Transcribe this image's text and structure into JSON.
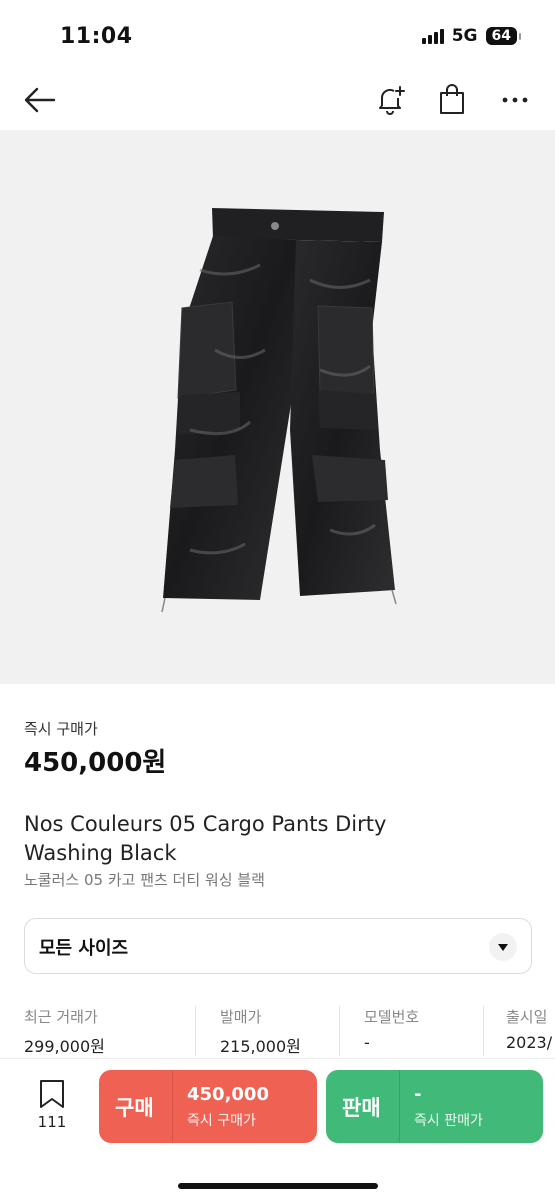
{
  "status_bar": {
    "time": "11:04",
    "network": "5G",
    "battery": "64"
  },
  "nav": {
    "back_icon": "arrow-left-icon",
    "icons": [
      "bell-plus-icon",
      "shopping-bag-icon",
      "more-horizontal-icon"
    ]
  },
  "product": {
    "price_label": "즉시 구매가",
    "price": "450,000원",
    "title_en": "Nos Couleurs 05 Cargo Pants Dirty Washing Black",
    "title_ko": "노쿨러스 05 카고 팬츠 더티 워싱 블랙",
    "size_select": "모든 사이즈"
  },
  "stats": [
    {
      "label": "최근 거래가",
      "value": "299,000원"
    },
    {
      "label": "발매가",
      "value": "215,000원"
    },
    {
      "label": "모델번호",
      "value": "-"
    },
    {
      "label": "출시일",
      "value": "2023/"
    }
  ],
  "bottom_bar": {
    "bookmark_count": "111",
    "buy": {
      "label": "구매",
      "price": "450,000",
      "sub": "즉시 구매가",
      "color": "#ef6253"
    },
    "sell": {
      "label": "판매",
      "price": "-",
      "sub": "즉시 판매가",
      "color": "#41b979"
    }
  }
}
